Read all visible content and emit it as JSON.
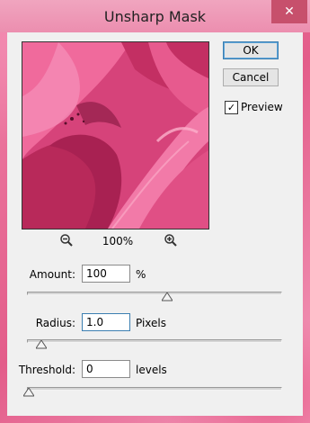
{
  "window": {
    "title": "Unsharp Mask",
    "close_symbol": "✕"
  },
  "buttons": {
    "ok_label": "OK",
    "cancel_label": "Cancel"
  },
  "preview": {
    "label": "Preview",
    "checked": true,
    "check_symbol": "✓",
    "zoom_level": "100%",
    "zoom_out_icon": "zoom-out-icon",
    "zoom_in_icon": "zoom-in-icon"
  },
  "params": {
    "amount": {
      "label": "Amount:",
      "value": "100",
      "unit": "%",
      "slider_fraction": 0.55
    },
    "radius": {
      "label": "Radius:",
      "value": "1.0",
      "unit": "Pixels",
      "slider_fraction": 0.05
    },
    "threshold": {
      "label": "Threshold:",
      "value": "0",
      "unit": "levels",
      "slider_fraction": 0.0
    }
  },
  "colors": {
    "accent": "#3c7fb1",
    "close_button": "#c7506c",
    "titlebar": "#ec8eaf",
    "dialog_bg": "#f0f0f0"
  }
}
